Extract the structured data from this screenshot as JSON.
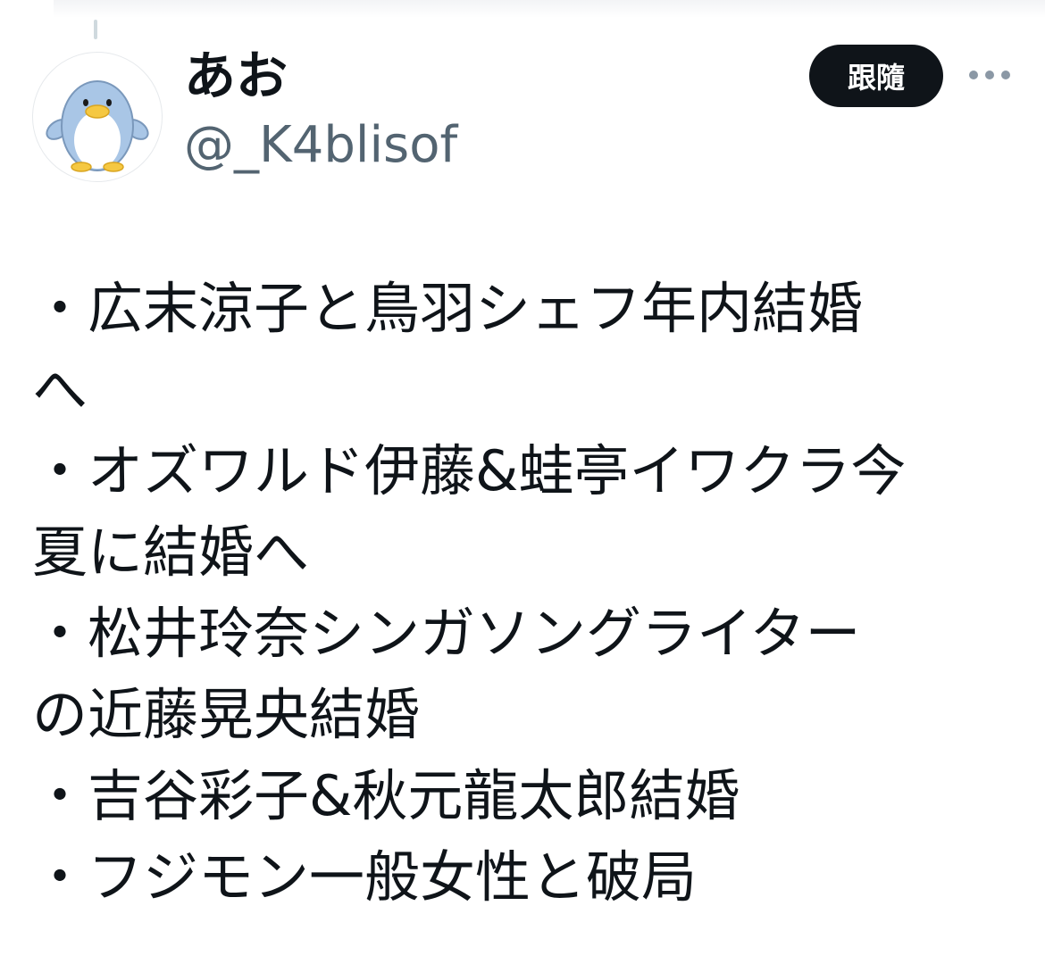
{
  "author": {
    "display_name": "あお",
    "handle": "@_K4blisof"
  },
  "actions": {
    "follow_label": "跟隨"
  },
  "icons": {
    "avatar": "penguin-avatar",
    "more": "more-options-icon"
  },
  "colors": {
    "text": "#0f1419",
    "secondary_text": "#536471",
    "follow_button_bg": "#0f1419",
    "follow_button_text": "#ffffff",
    "penguin_body": "#a9c6e6",
    "penguin_beak": "#f5c842"
  },
  "tweet": {
    "lines": [
      "・広末涼子と鳥羽シェフ年内結婚",
      "へ",
      "・オズワルド伊藤&蛙亭イワクラ今",
      "夏に結婚へ",
      "・松井玲奈シンガソングライター",
      "の近藤晃央結婚",
      "・吉谷彩子&秋元龍太郎結婚",
      "・フジモン一般女性と破局"
    ]
  }
}
